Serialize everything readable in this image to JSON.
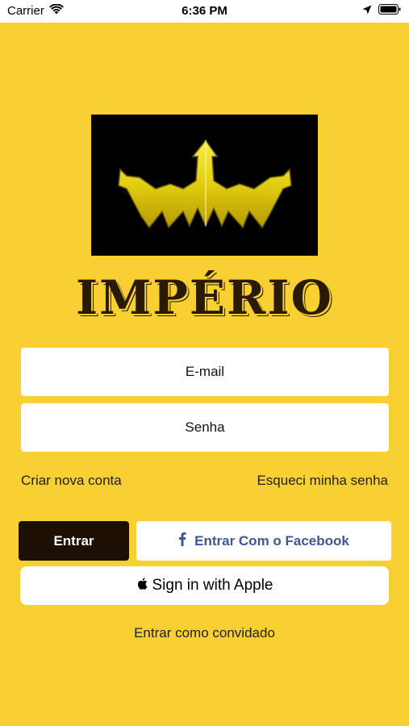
{
  "status_bar": {
    "carrier": "Carrier",
    "time": "6:36 PM",
    "icons": [
      "wifi-icon",
      "location-arrow-icon",
      "battery-icon"
    ]
  },
  "brand": {
    "logo_icon": "crown-icon",
    "name": "IMPÉRIO"
  },
  "form": {
    "email_placeholder": "E-mail",
    "password_placeholder": "Senha"
  },
  "links": {
    "create_account": "Criar nova conta",
    "forgot_password": "Esqueci minha senha"
  },
  "buttons": {
    "login": "Entrar",
    "facebook": "Entrar Com o Facebook",
    "apple": "Sign in with Apple",
    "guest": "Entrar como convidado"
  },
  "colors": {
    "background": "#F9D031",
    "login_button": "#1E0F04",
    "facebook_text": "#3B5998",
    "crown_gold": "#E8D21A"
  }
}
